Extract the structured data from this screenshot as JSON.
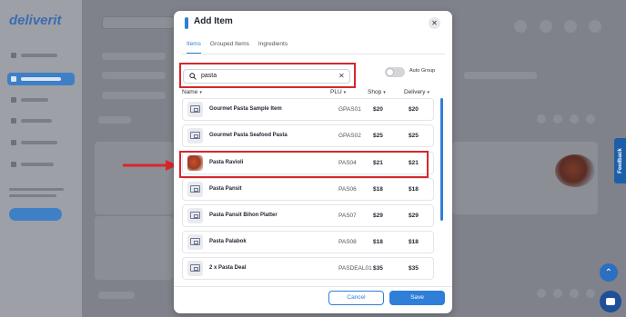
{
  "app": {
    "background_brand_color": "#3a6cb0",
    "feedback_label": "Feedback"
  },
  "modal": {
    "title": "Add Item",
    "close_icon": "close-icon",
    "tabs": [
      {
        "label": "Items",
        "active": true
      },
      {
        "label": "Grouped Items",
        "active": false
      },
      {
        "label": "Ingredients",
        "active": false
      }
    ],
    "search": {
      "value": "pasta",
      "icon": "search-icon",
      "clear_icon": "close-icon"
    },
    "auto_group": {
      "label": "Auto Group",
      "enabled": false
    },
    "columns": {
      "name": "Name",
      "plu": "PLU",
      "shop": "Shop",
      "delivery": "Delivery"
    },
    "items": [
      {
        "name": "Gourmet Pasta Sample Item",
        "plu": "GPAS01",
        "shop": "$20",
        "delivery": "$20",
        "thumb": "placeholder"
      },
      {
        "name": "Gourmet Pasta Seafood Pasta",
        "plu": "GPAS02",
        "shop": "$25",
        "delivery": "$25",
        "thumb": "placeholder"
      },
      {
        "name": "Pasta Ravioli",
        "plu": "PAS04",
        "shop": "$21",
        "delivery": "$21",
        "thumb": "photo"
      },
      {
        "name": "Pasta Pansit",
        "plu": "PAS06",
        "shop": "$18",
        "delivery": "$18",
        "thumb": "placeholder"
      },
      {
        "name": "Pasta Pansit Bihon Platter",
        "plu": "PAS07",
        "shop": "$29",
        "delivery": "$29",
        "thumb": "placeholder"
      },
      {
        "name": "Pasta Palabok",
        "plu": "PAS08",
        "shop": "$18",
        "delivery": "$18",
        "thumb": "placeholder"
      },
      {
        "name": "2 x Pasta Deal",
        "plu": "PASDEAL01",
        "shop": "$35",
        "delivery": "$35",
        "thumb": "placeholder"
      }
    ],
    "buttons": {
      "cancel": "Cancel",
      "save": "Save"
    }
  },
  "colors": {
    "accent": "#2f7ed8",
    "highlight": "#d9262c"
  }
}
